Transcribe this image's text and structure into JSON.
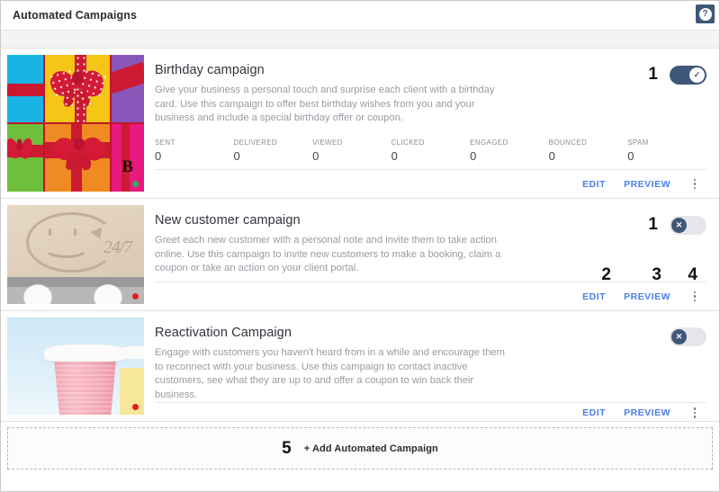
{
  "header": {
    "title": "Automated Campaigns",
    "help_icon": "question-mark-icon",
    "help_label": "?"
  },
  "stats_columns": [
    "SENT",
    "DELIVERED",
    "VIEWED",
    "CLICKED",
    "ENGAGED",
    "BOUNCED",
    "SPAM"
  ],
  "actions": {
    "edit_label": "EDIT",
    "preview_label": "PREVIEW",
    "menu_icon": "kebab-menu-icon"
  },
  "annotations": {
    "toggle_1": "1",
    "toggle_2": "1",
    "edit": "2",
    "preview": "3",
    "menu": "4",
    "add": "5"
  },
  "toggle": {
    "on_glyph": "✓",
    "off_glyph": "✕",
    "on_color": "#3f5878",
    "off_color": "#e6e6ea"
  },
  "campaigns": [
    {
      "title": "Birthday campaign",
      "description": "Give your business a personal touch and surprise each client with a birthday card. Use this campaign to offer best birthday wishes from you and your business and include a special birthday offer or coupon.",
      "enabled": true,
      "status_dot_color": "#2fae5e",
      "thumbnail": "gift-boxes-image",
      "stats": [
        "0",
        "0",
        "0",
        "0",
        "0",
        "0",
        "0"
      ]
    },
    {
      "title": "New customer campaign",
      "description": "Greet each new customer with a personal note and invite them to take action online. Use this campaign to invite new customers to make a booking, claim a coupon or take an action on your client portal.",
      "enabled": false,
      "status_dot_color": "#e02020",
      "thumbnail": "sand-smiley-247-image",
      "stats": []
    },
    {
      "title": "Reactivation Campaign",
      "description": "Engage with customers you haven't heard from in a while and encourage them to reconnect with your business. Use this campaign to contact inactive customers, see what they are up to and offer a coupon to win back their business.",
      "enabled": false,
      "status_dot_color": "#e02020",
      "thumbnail": "coffee-cup-image",
      "stats": []
    }
  ],
  "add_row": {
    "label": "+ Add Automated Campaign"
  }
}
